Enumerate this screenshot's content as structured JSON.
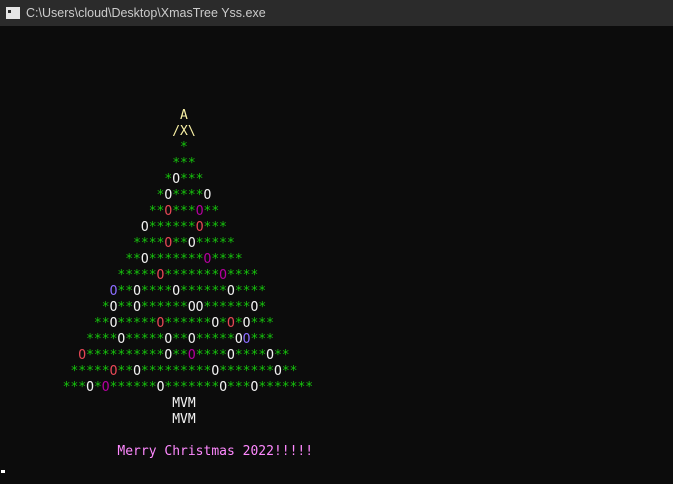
{
  "window": {
    "title": "C:\\Users\\cloud\\Desktop\\XmasTree Yss.exe"
  },
  "colors": {
    "green": "#16c60c",
    "yellow": "#f9f1a5",
    "red": "#e74856",
    "purple": "#b4009e",
    "violet": "#8b6dff",
    "white": "#f2f2f2",
    "pink": "#ff89ff"
  },
  "tree": {
    "rows": [
      {
        "indent": 23,
        "segs": [
          [
            "A",
            "yellow"
          ]
        ]
      },
      {
        "indent": 22,
        "segs": [
          [
            "/X\\",
            "yellow"
          ]
        ]
      },
      {
        "indent": 23,
        "segs": [
          [
            "*",
            "green"
          ]
        ]
      },
      {
        "indent": 22,
        "segs": [
          [
            "***",
            "green"
          ]
        ]
      },
      {
        "indent": 21,
        "segs": [
          [
            "*",
            "green"
          ],
          [
            "O",
            "white"
          ],
          [
            "***",
            "green"
          ]
        ]
      },
      {
        "indent": 20,
        "segs": [
          [
            "*",
            "green"
          ],
          [
            "O",
            "white"
          ],
          [
            "****",
            "green"
          ],
          [
            "O",
            "white"
          ]
        ]
      },
      {
        "indent": 19,
        "segs": [
          [
            "**",
            "green"
          ],
          [
            "O",
            "red"
          ],
          [
            "***",
            "green"
          ],
          [
            "O",
            "purple"
          ],
          [
            "**",
            "green"
          ]
        ]
      },
      {
        "indent": 18,
        "segs": [
          [
            "O",
            "white"
          ],
          [
            "******",
            "green"
          ],
          [
            "O",
            "red"
          ],
          [
            "***",
            "green"
          ]
        ]
      },
      {
        "indent": 17,
        "segs": [
          [
            "****",
            "green"
          ],
          [
            "O",
            "red"
          ],
          [
            "**",
            "green"
          ],
          [
            "O",
            "white"
          ],
          [
            "*****",
            "green"
          ]
        ]
      },
      {
        "indent": 16,
        "segs": [
          [
            "**",
            "green"
          ],
          [
            "O",
            "white"
          ],
          [
            "*******",
            "green"
          ],
          [
            "O",
            "purple"
          ],
          [
            "****",
            "green"
          ]
        ]
      },
      {
        "indent": 15,
        "segs": [
          [
            "*****",
            "green"
          ],
          [
            "O",
            "red"
          ],
          [
            "*******",
            "green"
          ],
          [
            "O",
            "purple"
          ],
          [
            "****",
            "green"
          ]
        ]
      },
      {
        "indent": 14,
        "segs": [
          [
            "O",
            "violet"
          ],
          [
            "**",
            "green"
          ],
          [
            "O",
            "white"
          ],
          [
            "****",
            "green"
          ],
          [
            "O",
            "white"
          ],
          [
            "******",
            "green"
          ],
          [
            "O",
            "white"
          ],
          [
            "****",
            "green"
          ]
        ]
      },
      {
        "indent": 13,
        "segs": [
          [
            "*",
            "green"
          ],
          [
            "O",
            "white"
          ],
          [
            "**",
            "green"
          ],
          [
            "O",
            "white"
          ],
          [
            "******",
            "green"
          ],
          [
            "OO",
            "white"
          ],
          [
            "******",
            "green"
          ],
          [
            "O",
            "white"
          ],
          [
            "*",
            "green"
          ]
        ]
      },
      {
        "indent": 12,
        "segs": [
          [
            "**",
            "green"
          ],
          [
            "O",
            "white"
          ],
          [
            "*****",
            "green"
          ],
          [
            "O",
            "red"
          ],
          [
            "******",
            "green"
          ],
          [
            "O",
            "white"
          ],
          [
            "*",
            "green"
          ],
          [
            "O",
            "red"
          ],
          [
            "*",
            "green"
          ],
          [
            "O",
            "white"
          ],
          [
            "***",
            "green"
          ]
        ]
      },
      {
        "indent": 11,
        "segs": [
          [
            "****",
            "green"
          ],
          [
            "O",
            "white"
          ],
          [
            "*****",
            "green"
          ],
          [
            "O",
            "white"
          ],
          [
            "**",
            "green"
          ],
          [
            "O",
            "white"
          ],
          [
            "*****",
            "green"
          ],
          [
            "O",
            "white"
          ],
          [
            "O",
            "violet"
          ],
          [
            "***",
            "green"
          ]
        ]
      },
      {
        "indent": 10,
        "segs": [
          [
            "O",
            "red"
          ],
          [
            "**********",
            "green"
          ],
          [
            "O",
            "white"
          ],
          [
            "**",
            "green"
          ],
          [
            "O",
            "purple"
          ],
          [
            "****",
            "green"
          ],
          [
            "O",
            "white"
          ],
          [
            "****",
            "green"
          ],
          [
            "O",
            "white"
          ],
          [
            "**",
            "green"
          ]
        ]
      },
      {
        "indent": 9,
        "segs": [
          [
            "*****",
            "green"
          ],
          [
            "O",
            "red"
          ],
          [
            "**",
            "green"
          ],
          [
            "O",
            "white"
          ],
          [
            "*********",
            "green"
          ],
          [
            "O",
            "white"
          ],
          [
            "*******",
            "green"
          ],
          [
            "O",
            "white"
          ],
          [
            "**",
            "green"
          ]
        ]
      },
      {
        "indent": 8,
        "segs": [
          [
            "***",
            "green"
          ],
          [
            "O",
            "white"
          ],
          [
            "*",
            "green"
          ],
          [
            "O",
            "purple"
          ],
          [
            "******",
            "green"
          ],
          [
            "O",
            "white"
          ],
          [
            "*******",
            "green"
          ],
          [
            "O",
            "white"
          ],
          [
            "***",
            "green"
          ],
          [
            "O",
            "white"
          ],
          [
            "*******",
            "green"
          ]
        ]
      },
      {
        "indent": 22,
        "segs": [
          [
            "MVM",
            "white"
          ]
        ]
      },
      {
        "indent": 22,
        "segs": [
          [
            "MVM",
            "white"
          ]
        ]
      },
      {
        "indent": 0,
        "segs": []
      },
      {
        "indent": 15,
        "segs": [
          [
            "Merry Christmas 2022!!!!!",
            "pink"
          ]
        ]
      }
    ]
  }
}
